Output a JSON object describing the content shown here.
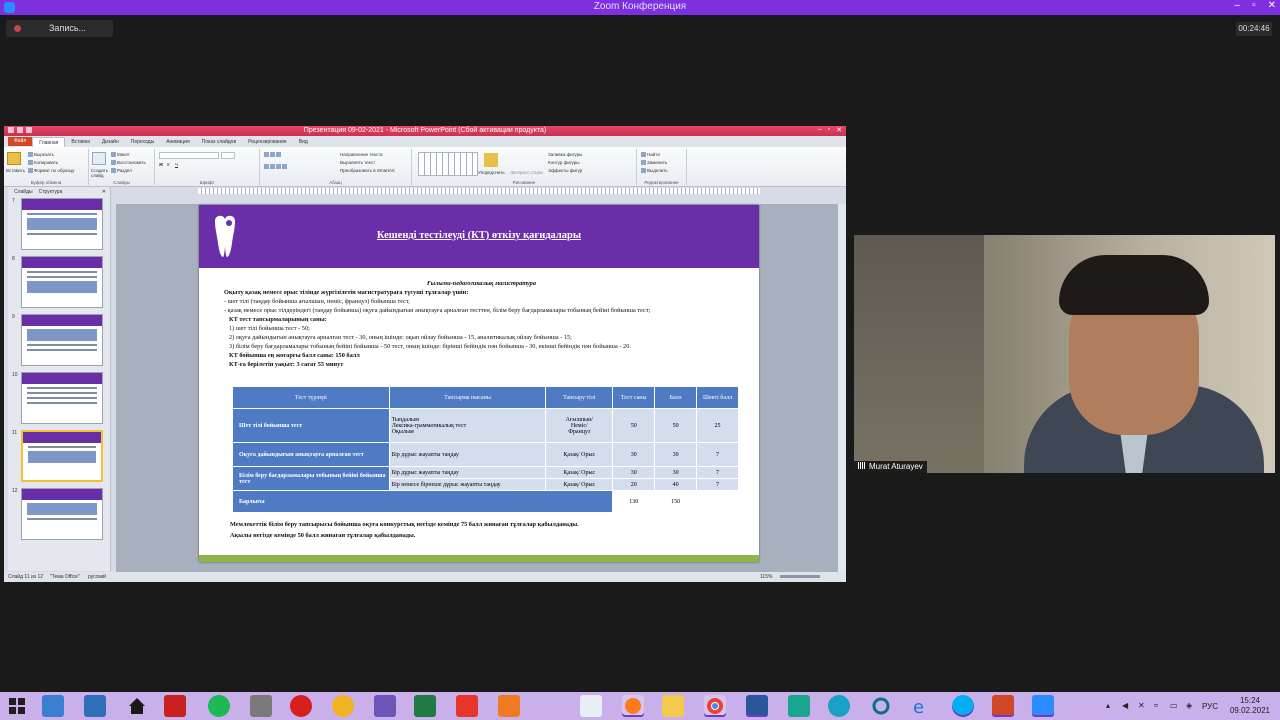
{
  "zoom": {
    "title": "Zoom Конференция",
    "recording_label": "Запись...",
    "timer": "00:24:46",
    "window_controls": [
      "–",
      "▫",
      "✕"
    ]
  },
  "powerpoint": {
    "window_title": "Презентация 09-02-2021 - Microsoft PowerPoint (Сбой активации продукта)",
    "tabs": [
      "Файл",
      "Главная",
      "Вставка",
      "Дизайн",
      "Переходы",
      "Анимация",
      "Показ слайдов",
      "Рецензирование",
      "Вид"
    ],
    "ribbon": {
      "clipboard": {
        "paste": "Вставить",
        "cut": "Вырезать",
        "copy": "Копировать",
        "format": "Формат по образцу",
        "label": "Буфер обмена"
      },
      "slides": {
        "create": "Создать слайд",
        "layout": "Макет",
        "reset": "Восстановить",
        "section": "Раздел",
        "label": "Слайды"
      },
      "font_label": "Шрифт",
      "paragraph": {
        "direction": "Направление текста",
        "align": "Выровнять текст",
        "smartart": "Преобразовать в SmartArt",
        "label": "Абзац"
      },
      "drawing": {
        "arrange": "Упорядочить",
        "quick_styles": "Экспресс-стили",
        "fill": "Заливка фигуры",
        "outline": "Контур фигуры",
        "effects": "Эффекты фигур",
        "label": "Рисование"
      },
      "editing": {
        "find": "Найти",
        "replace": "Заменить",
        "select": "Выделить",
        "label": "Редактирование"
      }
    },
    "pane_tabs": [
      "Слайды",
      "Структура"
    ],
    "thumbnail_numbers": [
      "7",
      "8",
      "9",
      "10",
      "11",
      "12"
    ],
    "status": {
      "slide": "Слайд 11 из 12",
      "theme": "\"Тема Office\"",
      "lang": "русский",
      "zoom": "115%"
    }
  },
  "slide": {
    "title": "Кешенді тестілеуді (КТ) өткізу қағидалары",
    "subtitle": "Ғылыми-педагогикалық магистратура",
    "lines": [
      "Оқыту қазақ немесе орыс тілінде жүргізілетін магистратураға түсуші тұлғалар үшін:",
      "- шет тілі (таңдау бойынша ағылшын, неміс, француз) бойынша тест,",
      "- қазақ немесе орыс тілдеріндегі (таңдау бойынша) оқуға дайындығын анықтауға арналған тесттен, білім беру бағдарламалары тобының бейіні бойынша тест;",
      "КТ тест тапсырмаларының саны:",
      "1) шет тілі бойынша тест - 50;",
      "2) оқуға дайындығын анықтауға арналған тест - 30, оның ішінде: оқып ойлау бойынша - 15, аналитикалық ойлау бойынша - 15;",
      "3) білім беру бағдарламалары тобының бейіні бойынша - 50 тест, оның ішінде: бірінші бейіндік пән бойынша - 30, екінші бейіндік пән бойынша - 20.",
      "КТ бойынша ең жоғарғы балл саны: 150 балл",
      "КТ-ға берілетін уақыт: 3 сағат 55 минут"
    ],
    "table": {
      "headers": [
        "Тест түрлері",
        "Тапсырма нысаны",
        "Тапсыру тілі",
        "Тест саны",
        "Балл",
        "Шекті балл"
      ],
      "rows": [
        {
          "type": "Шет тілі бойынша тест",
          "form": [
            "Тыңдалым",
            "Лексика-грамматикалық тест",
            "Оқылым"
          ],
          "lang": [
            "Ағылшын/",
            "Неміс/",
            "Француз"
          ],
          "count": "50",
          "score": "50",
          "threshold": "25"
        },
        {
          "type": "Оқуға дайындығын анықтауға арналған тест",
          "form": [
            "Бір дұрыс жауапты таңдау"
          ],
          "lang": [
            "Қазақ/ Орыс"
          ],
          "count": "30",
          "score": "30",
          "threshold": "7"
        },
        {
          "type": "Білім беру бағдарламалары тобының бейіні бойынша тест",
          "form": [
            "Бір дұрыс жауапты таңдау"
          ],
          "lang": [
            "Қазақ/ Орыс"
          ],
          "count": "30",
          "score": "30",
          "threshold": "7"
        },
        {
          "type": "",
          "form": [
            "Бір немесе бірнеше дұрыс жауапты таңдау"
          ],
          "lang": [
            "Қазақ/ Орыс"
          ],
          "count": "20",
          "score": "40",
          "threshold": "7"
        }
      ],
      "total": {
        "label": "Барлығы",
        "count": "130",
        "score": "150"
      }
    },
    "footer": [
      "Мемлекеттік білім беру тапсырысы бойынша оқуға конкурстық негізде кемінде 75 балл жинаған тұлғалар қабылданады.",
      "Ақылы негізде кемінде 50 балл жинаған тұлғалар қабылданады."
    ]
  },
  "webcam": {
    "name": "Murat Aturayev"
  },
  "taskbar": {
    "lang": "РУС",
    "time": "15:24",
    "date": "09.02.2021",
    "apps": [
      "start",
      "desktop-icon",
      "user-icon",
      "home-icon",
      "acrobat-icon",
      "spotify-icon",
      "network-icon",
      "opera-icon",
      "archicad-icon",
      "visual-studio-icon",
      "excel-icon",
      "yandex-icon",
      "media-icon",
      "notepad-icon",
      "firefox-icon",
      "explorer-icon",
      "chrome-icon",
      "word-icon",
      "app-icon",
      "teams-icon",
      "kaspersky-icon",
      "edge-icon",
      "skype-icon",
      "powerpoint-icon",
      "zoom-icon"
    ]
  }
}
